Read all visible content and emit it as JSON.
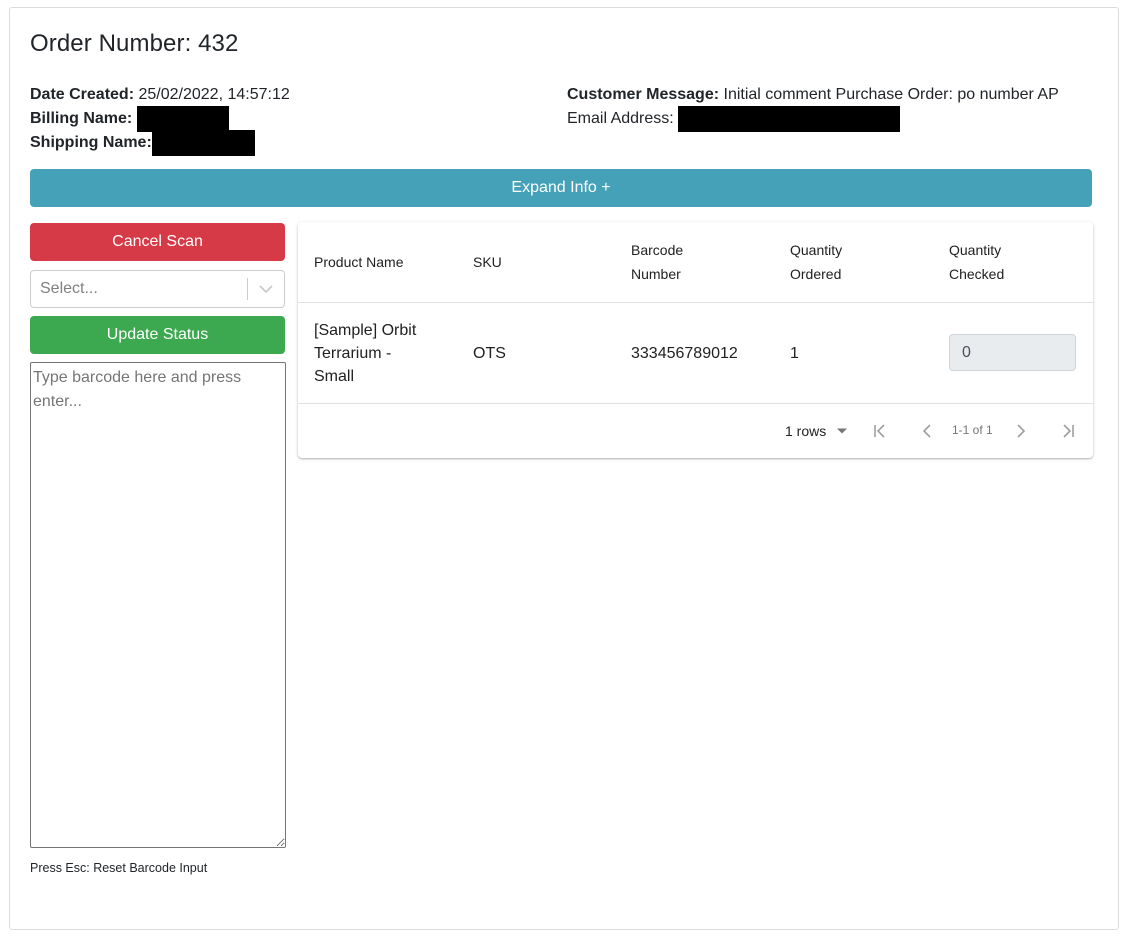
{
  "order": {
    "title": "Order Number: 432",
    "date_created_label": "Date Created:",
    "date_created_value": "25/02/2022, 14:57:12",
    "billing_name_label": "Billing Name:",
    "shipping_name_label": "Shipping Name:",
    "customer_message_label": "Customer Message:",
    "customer_message_value": "Initial comment Purchase Order: po number AP",
    "email_label": "Email Address:"
  },
  "expand_button": "Expand Info +",
  "sidebar": {
    "cancel_label": "Cancel Scan",
    "select_placeholder": "Select...",
    "update_label": "Update Status",
    "barcode_placeholder": "Type barcode here and press enter...",
    "hint": "Press Esc: Reset Barcode Input"
  },
  "table": {
    "headers": {
      "product": "Product Name",
      "sku": "SKU",
      "barcode_1": "Barcode",
      "barcode_2": "Number",
      "qty_ordered_1": "Quantity",
      "qty_ordered_2": "Ordered",
      "qty_checked_1": "Quantity",
      "qty_checked_2": "Checked"
    },
    "rows": [
      {
        "product_1": "[Sample] Orbit",
        "product_2": "Terrarium -",
        "product_3": "Small",
        "sku": "OTS",
        "barcode": "333456789012",
        "qty_ordered": "1",
        "qty_checked": "0"
      }
    ],
    "pagination": {
      "rows_label": "1 rows",
      "range": "1-1 of 1"
    }
  },
  "colors": {
    "info_button": "#45a1b8",
    "danger_button": "#d63a47",
    "success_button": "#3ca84f"
  }
}
